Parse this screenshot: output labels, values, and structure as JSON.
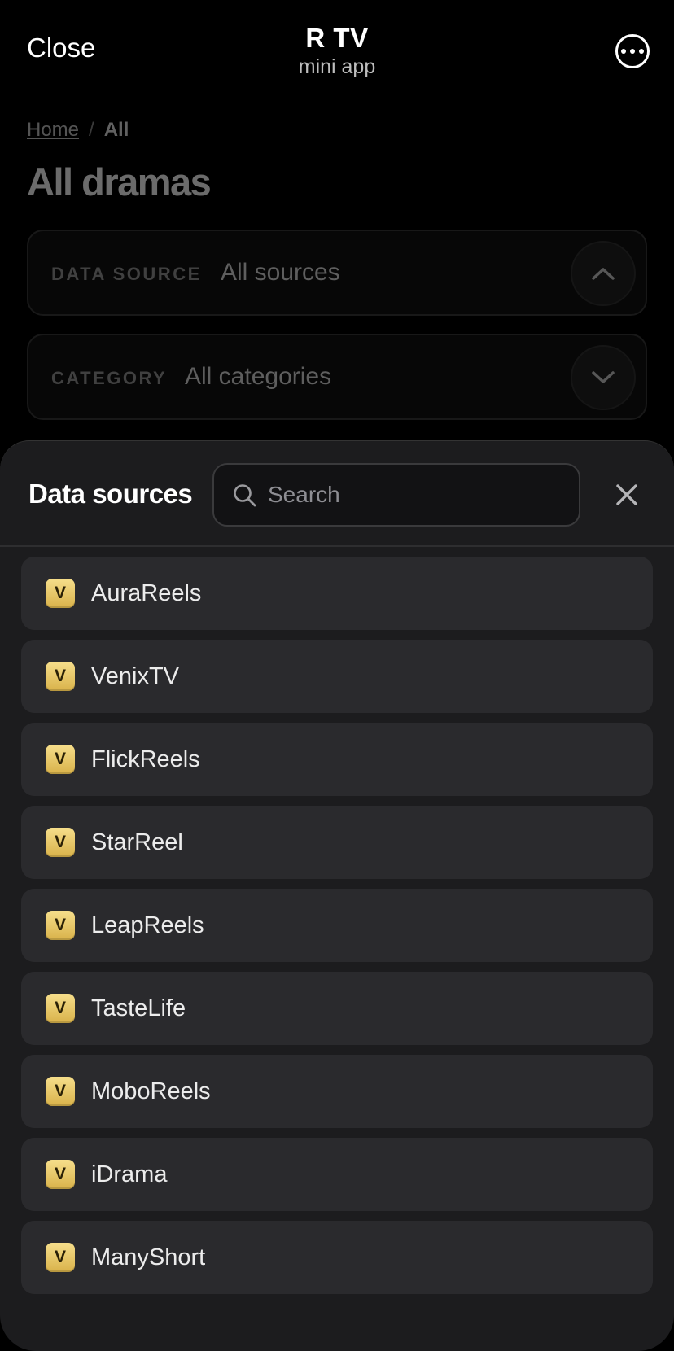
{
  "topbar": {
    "close_label": "Close",
    "app_title": "R TV",
    "app_subtitle": "mini app",
    "more_icon": "ellipsis-circle-icon"
  },
  "breadcrumb": {
    "home": "Home",
    "separator": "/",
    "current": "All"
  },
  "page_title": "All dramas",
  "filters": [
    {
      "label": "DATA SOURCE",
      "value": "All sources",
      "chevron": "chevron-up-icon"
    },
    {
      "label": "CATEGORY",
      "value": "All categories",
      "chevron": "chevron-down-icon"
    }
  ],
  "sheet": {
    "title": "Data sources",
    "search_placeholder": "Search",
    "search_value": "",
    "close_icon": "close-icon",
    "badge_letter": "V",
    "badge_color": "#e8c45e",
    "items": [
      {
        "label": "AuraReels"
      },
      {
        "label": "VenixTV"
      },
      {
        "label": "FlickReels"
      },
      {
        "label": "StarReel"
      },
      {
        "label": "LeapReels"
      },
      {
        "label": "TasteLife"
      },
      {
        "label": "MoboReels"
      },
      {
        "label": "iDrama"
      },
      {
        "label": "ManyShort"
      }
    ]
  }
}
